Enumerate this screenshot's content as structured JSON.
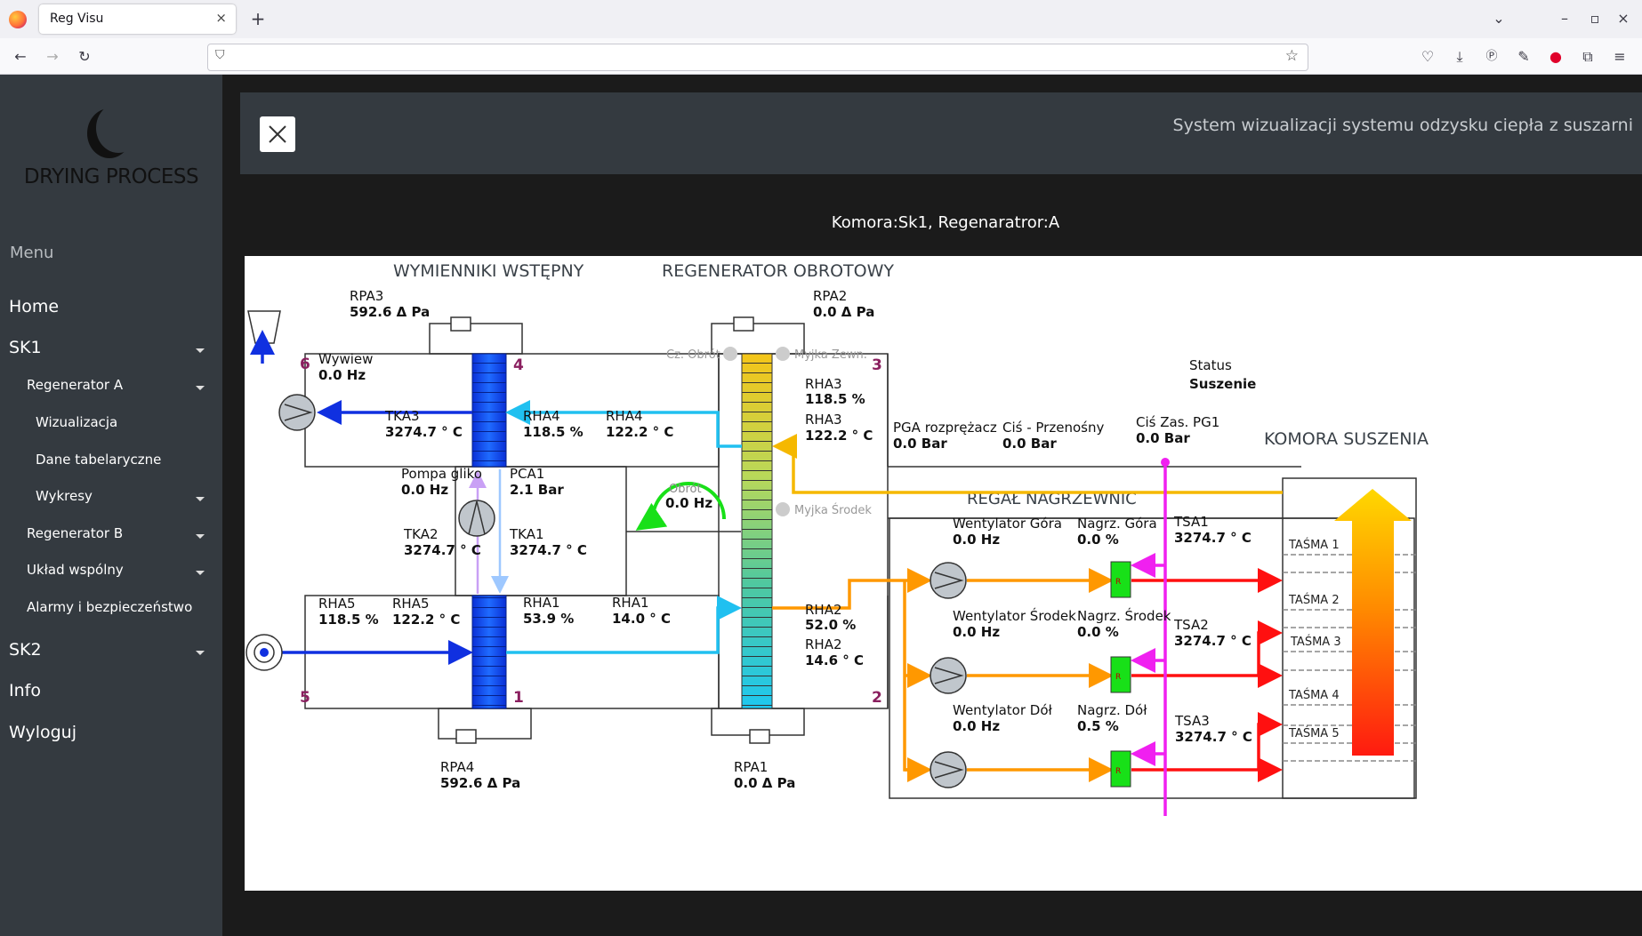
{
  "browser": {
    "tab_title": "Reg Visu",
    "tab_close": "×",
    "new_tab": "+",
    "url": ""
  },
  "sidebar": {
    "brand": "DRYING PROCESS",
    "menu_title": "Menu",
    "items": [
      {
        "label": "Home"
      },
      {
        "label": "SK1"
      },
      {
        "label": "Regenerator A"
      },
      {
        "label": "Wizualizacja"
      },
      {
        "label": "Dane tabelaryczne"
      },
      {
        "label": "Wykresy"
      },
      {
        "label": "Regenerator B"
      },
      {
        "label": "Układ wspólny"
      },
      {
        "label": "Alarmy i bezpieczeństwo"
      },
      {
        "label": "SK2"
      },
      {
        "label": "Info"
      },
      {
        "label": "Wyloguj"
      }
    ]
  },
  "header": {
    "system_title": "System wizualizacji systemu odzysku ciepła z suszarni"
  },
  "chamber_title": "Komora:Sk1, Regenaratror:A",
  "diagram": {
    "section_titles": {
      "pre": "WYMIENNIKI WSTĘPNY",
      "regen": "REGENERATOR OBROTOWY",
      "chamber": "KOMORA SUSZENIA",
      "heaters": "REGAŁ NAGRZEWNIC"
    },
    "zones": {
      "z1": "1",
      "z2": "2",
      "z3": "3",
      "z4": "4",
      "z5": "5",
      "z6": "6"
    },
    "rpa3": {
      "label": "RPA3",
      "value": "592.6 Δ Pa"
    },
    "rpa2": {
      "label": "RPA2",
      "value": "0.0 Δ Pa"
    },
    "rpa4": {
      "label": "RPA4",
      "value": "592.6 Δ Pa"
    },
    "rpa1": {
      "label": "RPA1",
      "value": "0.0 Δ Pa"
    },
    "wywiew": {
      "label": "Wywiew",
      "value": "0.0 Hz"
    },
    "tka3": {
      "label": "TKA3",
      "value": "3274.7 ° C"
    },
    "rha4_h": {
      "label": "RHA4",
      "value": "118.5 %"
    },
    "rha4_t": {
      "label": "RHA4",
      "value": "122.2 ° C"
    },
    "rha3_h": {
      "label": "RHA3",
      "value": "118.5 %"
    },
    "rha3_t": {
      "label": "RHA3",
      "value": "122.2 ° C"
    },
    "cz_obrot": "Cz. Obrót",
    "myjka_zewn": "Myjka Zewn.",
    "myjka_srodek": "Myjka Środek",
    "pompa": {
      "label": "Pompa gliko",
      "value": "0.0 Hz"
    },
    "pca1": {
      "label": "PCA1",
      "value": "2.1 Bar"
    },
    "tka2": {
      "label": "TKA2",
      "value": "3274.7 ° C"
    },
    "tka1": {
      "label": "TKA1",
      "value": "3274.7 ° C"
    },
    "obrot": {
      "label": "Obrót",
      "value": "0.0 Hz"
    },
    "rha5_h": {
      "label": "RHA5",
      "value": "118.5 %"
    },
    "rha5_t": {
      "label": "RHA5",
      "value": "122.2 ° C"
    },
    "rha1_h": {
      "label": "RHA1",
      "value": "53.9 %"
    },
    "rha1_t": {
      "label": "RHA1",
      "value": "14.0 ° C"
    },
    "rha2_h": {
      "label": "RHA2",
      "value": "52.0 %"
    },
    "rha2_t": {
      "label": "RHA2",
      "value": "14.6 ° C"
    },
    "status": {
      "label": "Status",
      "value": "Suszenie"
    },
    "pga": {
      "label": "PGA rozprężacz",
      "value": "0.0 Bar"
    },
    "cis_przen": {
      "label": "Ciś - Przenośny",
      "value": "0.0 Bar"
    },
    "cis_zas": {
      "label": "Ciś Zas. PG1",
      "value": "0.0 Bar"
    },
    "went_gora": {
      "label": "Wentylator Góra",
      "value": "0.0 Hz"
    },
    "nagrz_gora": {
      "label": "Nagrz. Góra",
      "value": "0.0 %"
    },
    "tsa1": {
      "label": "TSA1",
      "value": "3274.7 ° C"
    },
    "went_srodek": {
      "label": "Wentylator Środek",
      "value": "0.0 Hz"
    },
    "nagrz_srodek": {
      "label": "Nagrz. Środek",
      "value": "0.0 %"
    },
    "tsa2": {
      "label": "TSA2",
      "value": "3274.7 ° C"
    },
    "went_dol": {
      "label": "Wentylator Dół",
      "value": "0.0 Hz"
    },
    "nagrz_dol": {
      "label": "Nagrz. Dół",
      "value": "0.5 %"
    },
    "tsa3": {
      "label": "TSA3",
      "value": "3274.7 ° C"
    },
    "heater_mark": "R",
    "belts": [
      "TAŚMA 1",
      "TAŚMA 2",
      "TAŚMA 3",
      "TAŚMA 4",
      "TAŚMA 5"
    ]
  }
}
